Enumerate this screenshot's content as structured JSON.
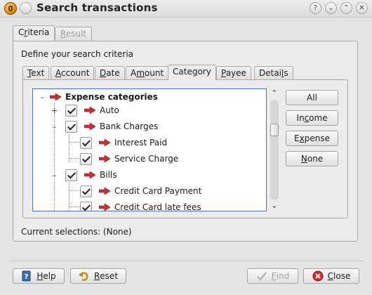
{
  "window": {
    "title": "Search transactions"
  },
  "tabs": [
    {
      "label_pre": "C",
      "label_u": "r",
      "label_post": "iteria"
    },
    {
      "label_pre": "",
      "label_u": "R",
      "label_post": "esult"
    }
  ],
  "criteria": {
    "heading": "Define your search criteria",
    "tabs": [
      {
        "pre": "",
        "u": "T",
        "post": "ext"
      },
      {
        "pre": "",
        "u": "A",
        "post": "ccount"
      },
      {
        "pre": "",
        "u": "D",
        "post": "ate"
      },
      {
        "pre": "A",
        "u": "m",
        "post": "ount"
      },
      {
        "pre": "Cate",
        "u": "g",
        "post": "ory"
      },
      {
        "pre": "",
        "u": "P",
        "post": "ayee"
      },
      {
        "pre": "Detai",
        "u": "l",
        "post": "s"
      }
    ]
  },
  "tree": {
    "items": [
      {
        "label": "Expense categories"
      },
      {
        "label": "Auto"
      },
      {
        "label": "Bank Charges"
      },
      {
        "label": "Interest Paid"
      },
      {
        "label": "Service Charge"
      },
      {
        "label": "Bills"
      },
      {
        "label": "Credit Card Payment"
      },
      {
        "label": "Credit Card late fees"
      }
    ]
  },
  "side_buttons": [
    {
      "pre": "All",
      "u": "",
      "post": ""
    },
    {
      "pre": "In",
      "u": "c",
      "post": "ome"
    },
    {
      "pre": "E",
      "u": "x",
      "post": "pense"
    },
    {
      "pre": "",
      "u": "N",
      "post": "one"
    }
  ],
  "status": {
    "current_selections": "Current selections: (None)"
  },
  "footer": {
    "help": {
      "u": "H",
      "post": "elp"
    },
    "reset": {
      "u": "R",
      "post": "eset"
    },
    "find": {
      "u": "F",
      "post": "ind"
    },
    "close": {
      "u": "C",
      "post": "lose"
    }
  },
  "colors": {
    "accent": "#4a76b8",
    "arrow": "#c83232",
    "close_icon": "#d42a2a"
  }
}
